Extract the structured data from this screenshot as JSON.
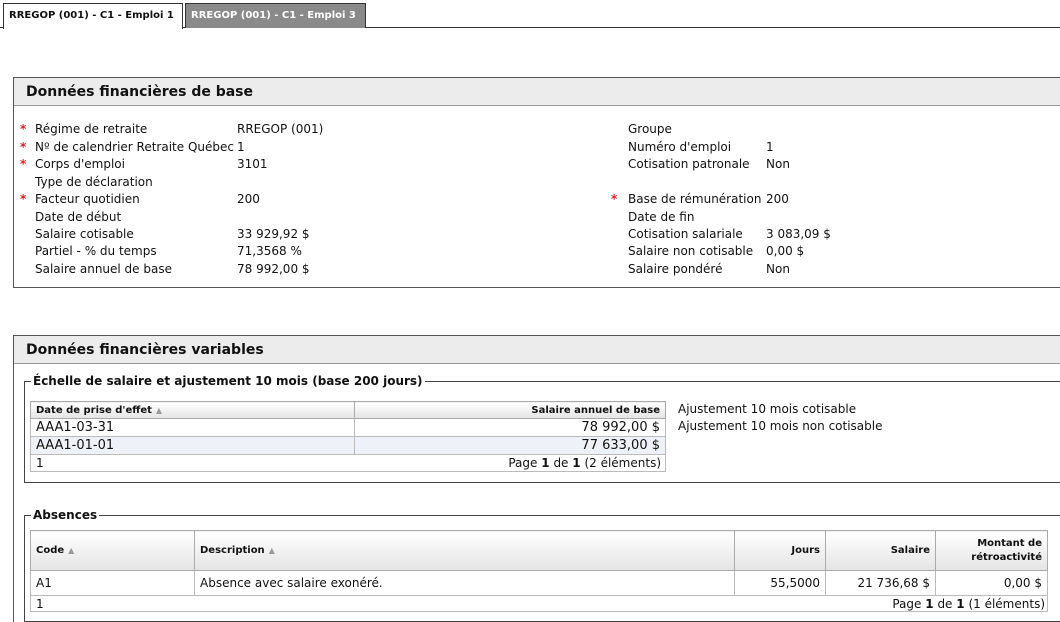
{
  "tabs": [
    {
      "label": "RREGOP (001) - C1 - Emploi 1"
    },
    {
      "label": "RREGOP (001) - C1 - Emploi 3"
    }
  ],
  "base": {
    "title": "Données financières de base",
    "left": [
      {
        "label": "Régime de retraite",
        "value": "RREGOP (001)"
      },
      {
        "label": "Nº de calendrier Retraite Québec",
        "value": "1"
      },
      {
        "label": "Corps d'emploi",
        "value": "3101"
      },
      {
        "label": "Type de déclaration",
        "value": ""
      },
      {
        "label": "Facteur quotidien",
        "value": "200"
      },
      {
        "label": "Date de début",
        "value": ""
      },
      {
        "label": "Salaire cotisable",
        "value": "33 929,92 $"
      },
      {
        "label": "Partiel - % du temps",
        "value": "71,3568 %"
      },
      {
        "label": "Salaire annuel de base",
        "value": "78 992,00 $"
      }
    ],
    "right": [
      {
        "label": "Groupe",
        "value": ""
      },
      {
        "label": "Numéro d'emploi",
        "value": "1"
      },
      {
        "label": "Cotisation patronale",
        "value": "Non"
      },
      {
        "label": "Base de rémunération",
        "value": "200"
      },
      {
        "label": "Date de fin",
        "value": ""
      },
      {
        "label": "Cotisation salariale",
        "value": "3 083,09 $"
      },
      {
        "label": "Salaire non cotisable",
        "value": "0,00 $"
      },
      {
        "label": "Salaire pondéré",
        "value": "Non"
      }
    ],
    "required_marker": "*"
  },
  "variable": {
    "title": "Données financières variables",
    "scale": {
      "legend": "Échelle de salaire et ajustement 10 mois (base 200 jours)",
      "columns": [
        "Date de prise d'effet",
        "Salaire annuel de base"
      ],
      "rows": [
        {
          "date": "AAA1-03-31",
          "salary": "78 992,00 $"
        },
        {
          "date": "AAA1-01-01",
          "salary": "77 633,00 $"
        }
      ],
      "pager": {
        "page_num": "1",
        "text_page": "Page",
        "current": "1",
        "text_of": "de",
        "total": "1",
        "count": "(2 éléments)"
      },
      "adjust1": "Ajustement 10 mois cotisable",
      "adjust2": "Ajustement 10 mois non cotisable"
    },
    "absences": {
      "legend": "Absences",
      "columns": [
        "Code",
        "Description",
        "Jours",
        "Salaire",
        "Montant de rétroactivité"
      ],
      "rows": [
        {
          "code": "A1",
          "description": "Absence avec salaire exonéré.",
          "days": "55,5000",
          "salary": "21 736,68 $",
          "retro": "0,00 $"
        }
      ],
      "pager": {
        "page_num": "1",
        "text_page": "Page",
        "current": "1",
        "text_of": "de",
        "total": "1",
        "count": "(1 éléments)"
      }
    }
  }
}
